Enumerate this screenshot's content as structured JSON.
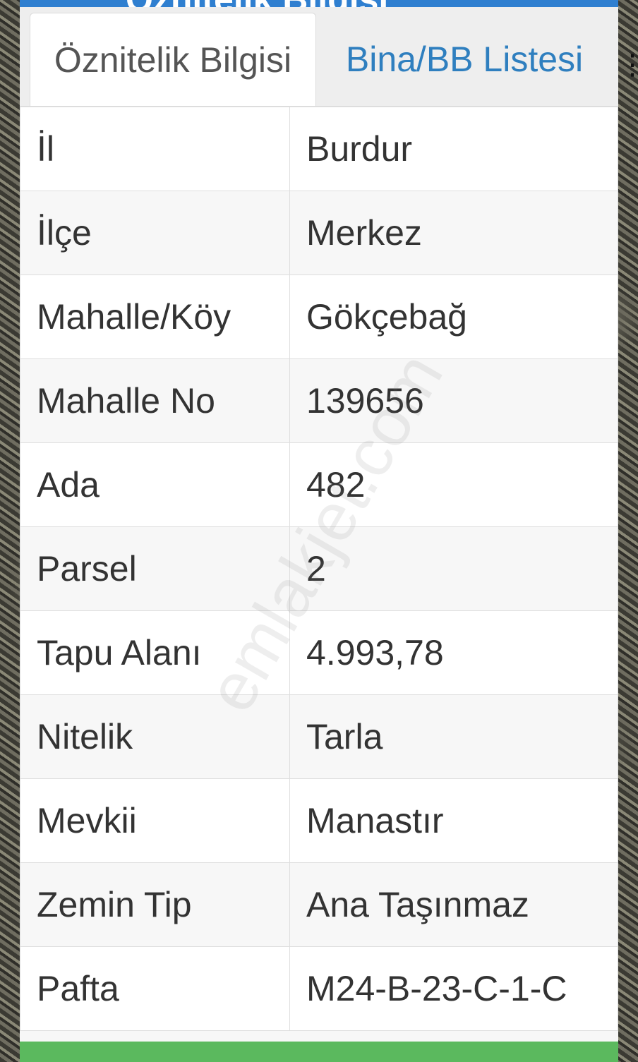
{
  "header": {
    "title_partial": "Öznitelik Bilgisi"
  },
  "tabs": [
    {
      "label": "Öznitelik Bilgisi",
      "active": true
    },
    {
      "label": "Bina/BB Listesi",
      "active": false
    }
  ],
  "attributes": [
    {
      "key": "İl",
      "value": "Burdur"
    },
    {
      "key": "İlçe",
      "value": "Merkez"
    },
    {
      "key": "Mahalle/Köy",
      "value": "Gökçebağ"
    },
    {
      "key": "Mahalle No",
      "value": "139656"
    },
    {
      "key": "Ada",
      "value": "482"
    },
    {
      "key": "Parsel",
      "value": "2"
    },
    {
      "key": "Tapu Alanı",
      "value": "4.993,78"
    },
    {
      "key": "Nitelik",
      "value": "Tarla"
    },
    {
      "key": "Mevkii",
      "value": "Manastır"
    },
    {
      "key": "Zemin Tip",
      "value": "Ana Taşınmaz"
    },
    {
      "key": "Pafta",
      "value": "M24-B-23-C-1-C"
    }
  ],
  "watermark": "emlakjet.com",
  "colors": {
    "accent_blue": "#2f7fd0",
    "tab_link": "#2f7fbf",
    "footer_green": "#5bb95e"
  }
}
